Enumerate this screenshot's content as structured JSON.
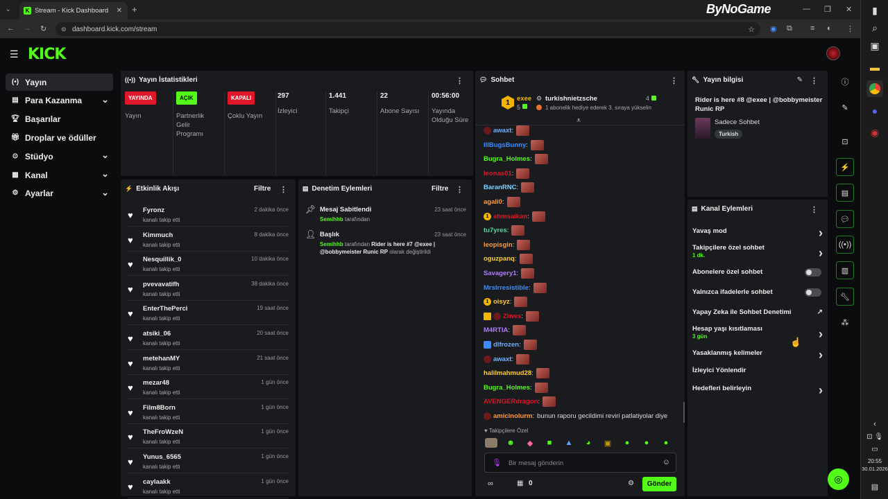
{
  "browser": {
    "tab_title": "Stream - Kick Dashboard",
    "url": "dashboard.kick.com/stream",
    "brand_watermark": "ByNoGame"
  },
  "sidebar": {
    "items": [
      {
        "label": "Yayın",
        "icon": "broadcast-icon",
        "chevron": false
      },
      {
        "label": "Para Kazanma",
        "icon": "money-icon",
        "chevron": true
      },
      {
        "label": "Başarılar",
        "icon": "trophy-icon",
        "chevron": false
      },
      {
        "label": "Droplar ve ödüller",
        "icon": "gift-icon",
        "chevron": false
      },
      {
        "label": "Stüdyo",
        "icon": "studio-icon",
        "chevron": true
      },
      {
        "label": "Kanal",
        "icon": "channel-icon",
        "chevron": true
      },
      {
        "label": "Ayarlar",
        "icon": "gear-icon",
        "chevron": true
      }
    ]
  },
  "stats": {
    "title": "Yayın İstatistikleri",
    "items": [
      {
        "badge": "YAYINDA",
        "label": "Yayın",
        "color": "#e0162b"
      },
      {
        "badge": "AÇIK",
        "label": "Partnerlik Gelir Programı",
        "color": "#53fc18"
      },
      {
        "badge": "KAPALI",
        "label": "Çoklu Yayın",
        "color": "#e0162b"
      },
      {
        "value": "297",
        "label": "İzleyici"
      },
      {
        "value": "1.441",
        "label": "Takipçi"
      },
      {
        "value": "22",
        "label": "Abone Sayısı"
      },
      {
        "value": "00:56:00",
        "label": "Yayında Olduğu Süre"
      }
    ]
  },
  "activity": {
    "title": "Etkinlik Akışı",
    "filter": "Filtre",
    "sub": "kanalı takip etti",
    "events": [
      {
        "name": "Fyronz",
        "time": "2 dakika önce"
      },
      {
        "name": "Kimmuch",
        "time": "8 dakika önce"
      },
      {
        "name": "Nesquillik_0",
        "time": "10 dakika önce"
      },
      {
        "name": "pvevavatifh",
        "time": "38 dakika önce"
      },
      {
        "name": "EnterThePerci",
        "time": "19 saat önce"
      },
      {
        "name": "atsiki_06",
        "time": "20 saat önce"
      },
      {
        "name": "metehanMY",
        "time": "21 saat önce"
      },
      {
        "name": "mezar48",
        "time": "1 gün önce"
      },
      {
        "name": "Film8Born",
        "time": "1 gün önce"
      },
      {
        "name": "TheFroWzeN",
        "time": "1 gün önce"
      },
      {
        "name": "Yunus_6565",
        "time": "1 gün önce"
      },
      {
        "name": "caylaakk",
        "time": "1 gün önce"
      }
    ]
  },
  "moderation": {
    "title": "Denetim Eylemleri",
    "filter": "Filtre",
    "items": [
      {
        "title": "Mesaj Sabitlendi",
        "time": "23 saat önce",
        "user": "Semihhb",
        "suffix": "tarafından",
        "detail": ""
      },
      {
        "title": "Başlık",
        "time": "23 saat önce",
        "user": "Semihhb",
        "suffix": "tarafından",
        "detail": "Rider is here #7 @exee | @bobbymeister Runic RP",
        "tail": "olarak değiştirildi"
      }
    ]
  },
  "chat": {
    "title": "Sohbet",
    "pinned": {
      "user1": "exee",
      "user1_count": "5",
      "user2": "turkishnietzsche",
      "user2_count": "4",
      "text": "1 abonelik hediye ederek 3. sıraya yükselin"
    },
    "messages": [
      {
        "user": "awaxt",
        "color": "#6fb2ff",
        "text": ""
      },
      {
        "user": "IIIBugsBunny",
        "color": "#3c8cff",
        "text": ""
      },
      {
        "user": "Bugra_Holmes",
        "color": "#53fc18",
        "text": ""
      },
      {
        "user": "leonas01",
        "color": "#e0162b",
        "text": ""
      },
      {
        "user": "BaranRNC",
        "color": "#7fd4ff",
        "text": ""
      },
      {
        "user": "agali0",
        "color": "#ff9b3c",
        "text": ""
      },
      {
        "user": "ahmsaikan",
        "color": "#e0162b",
        "text": ""
      },
      {
        "user": "tu7yres",
        "color": "#53d8a0",
        "text": ""
      },
      {
        "user": "leopisgin",
        "color": "#ff9b3c",
        "text": ""
      },
      {
        "user": "oguzpanq",
        "color": "#ffcc33",
        "text": ""
      },
      {
        "user": "Savagery1",
        "color": "#b27cff",
        "text": ""
      },
      {
        "user": "MrsIrresistible",
        "color": "#3c8cff",
        "text": ""
      },
      {
        "user": "oisyz",
        "color": "#ffcc33",
        "text": ""
      },
      {
        "user": "Ziwes",
        "color": "#e0162b",
        "text": ""
      },
      {
        "user": "M4RTIA",
        "color": "#b27cff",
        "text": ""
      },
      {
        "user": "dlfrozen",
        "color": "#6fb2ff",
        "text": ""
      },
      {
        "user": "awaxt",
        "color": "#6fb2ff",
        "text": ""
      },
      {
        "user": "halilmahmud28",
        "color": "#ffcc33",
        "text": ""
      },
      {
        "user": "Bugra_Holmes",
        "color": "#53fc18",
        "text": ""
      },
      {
        "user": "AVENGERdragon",
        "color": "#e0162b",
        "text": ""
      },
      {
        "user": "amicinolurm",
        "color": "#ff9b3c",
        "text": "bunun raporu gecildimi reviri patlatiyolar diye"
      }
    ],
    "follower_only": "Takipçilere Özel",
    "input_placeholder": "Bir mesaj gönderin",
    "count": "0",
    "send": "Gönder"
  },
  "stream_info": {
    "title": "Yayın bilgisi",
    "stream_title": "Rider is here #8 @exee | @bobbymeister Runic RP",
    "category": "Sadece Sohbet",
    "language": "Turkish"
  },
  "channel_actions": {
    "title": "Kanal Eylemleri",
    "items": [
      {
        "label": "Yavaş mod",
        "sub": "",
        "ctrl": "arrow"
      },
      {
        "label": "Takipçilere özel sohbet",
        "sub": "1 dk.",
        "ctrl": "arrow"
      },
      {
        "label": "Abonelere özel sohbet",
        "sub": "",
        "ctrl": "toggle"
      },
      {
        "label": "Yalnızca ifadelerle sohbet",
        "sub": "",
        "ctrl": "toggle"
      },
      {
        "label": "Yapay Zeka ile Sohbet Denetimi",
        "sub": "",
        "ctrl": "ext"
      },
      {
        "label": "Hesap yaşı kısıtlaması",
        "sub": "3 gün",
        "ctrl": "arrow"
      },
      {
        "label": "Yasaklanmış kelimeler",
        "sub": "",
        "ctrl": "arrow"
      },
      {
        "label": "İzleyici Yönlendir",
        "sub": "",
        "ctrl": "none"
      },
      {
        "label": "Hedefleri belirleyin",
        "sub": "",
        "ctrl": "arrow"
      }
    ]
  },
  "taskbar": {
    "time": "20:55",
    "date": "30.01.2026"
  }
}
